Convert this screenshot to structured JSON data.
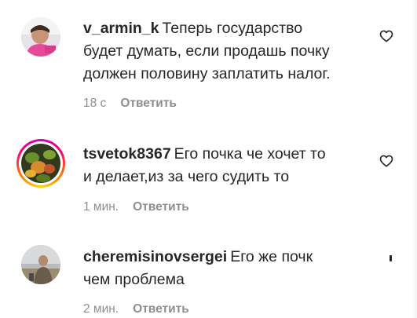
{
  "comments": [
    {
      "username": "v_armin_k",
      "text_line1": "Теперь государство",
      "text_line2": "будет думать, если продашь почку",
      "text_line3": "должен половину заплатить налог.",
      "time": "18 с",
      "reply": "Ответить",
      "avatar_icon": "user-photo"
    },
    {
      "username": "tsvetok8367",
      "text_line1": "Его почка че хочет то",
      "text_line2": "и делает,из за чего судить то",
      "time": "1 мин.",
      "reply": "Ответить",
      "avatar_icon": "user-photo-story-ring"
    },
    {
      "username": "cheremisinovsergei",
      "text_line1": "Его же почк",
      "text_line2": "чем проблема",
      "time": "2 мин.",
      "reply": "Ответить",
      "avatar_icon": "user-photo"
    }
  ],
  "icons": {
    "like": "heart-outline-icon"
  },
  "colors": {
    "text": "#262626",
    "muted": "#8e8e8e"
  }
}
